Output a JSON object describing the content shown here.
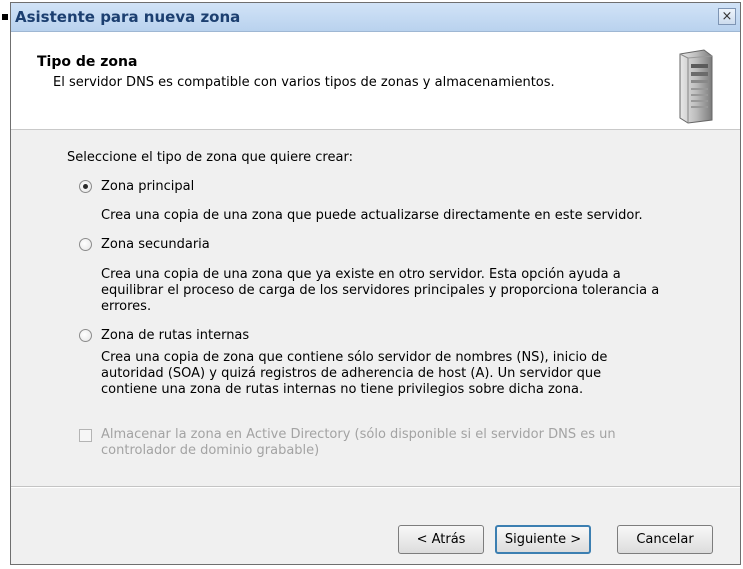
{
  "window": {
    "title": "Asistente para nueva zona",
    "close_label": "×"
  },
  "header": {
    "title": "Tipo de zona",
    "subtitle": "El servidor DNS es compatible con varios tipos de zonas y almacenamientos.",
    "icon": "server-icon"
  },
  "content": {
    "prompt": "Seleccione el tipo de zona que quiere crear:",
    "options": [
      {
        "label": "Zona principal",
        "selected": true,
        "description": [
          "Crea una copia de una zona que puede actualizarse directamente en este servidor."
        ]
      },
      {
        "label": "Zona secundaria",
        "selected": false,
        "description": [
          "Crea una copia de una zona que ya existe en otro servidor. Esta opción ayuda a",
          "equilibrar el proceso de carga de los servidores principales y proporciona tolerancia a",
          "errores."
        ]
      },
      {
        "label": "Zona de rutas internas",
        "selected": false,
        "description": [
          "Crea una copia de zona que contiene sólo servidor de nombres (NS), inicio de",
          "autoridad (SOA) y quizá registros de adherencia de host (A). Un servidor que",
          "contiene una zona de rutas internas no tiene privilegios sobre dicha zona."
        ]
      }
    ],
    "ad_checkbox": {
      "lines": [
        "Almacenar la zona en Active Directory (sólo disponible si el servidor DNS es un",
        "controlador de dominio grabable)"
      ],
      "checked": false,
      "enabled": false
    }
  },
  "buttons": {
    "back": "< Atrás",
    "next": "Siguiente >",
    "cancel": "Cancelar"
  }
}
